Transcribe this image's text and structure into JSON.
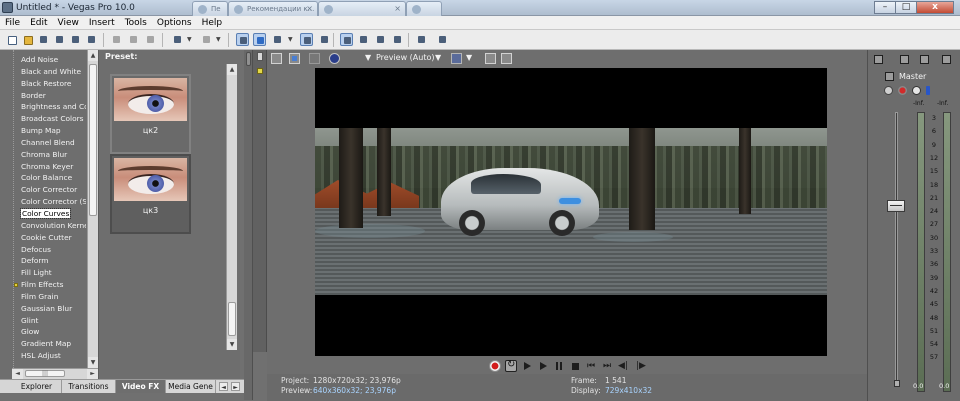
{
  "window": {
    "title": "Untitled * - Vegas Pro 10.0",
    "tabs": [
      {
        "label": "Пе"
      },
      {
        "label": "Рекомендации к..."
      },
      {
        "label": ""
      },
      {
        "label": ""
      }
    ],
    "controls": {
      "minimize": "–",
      "maximize": "□",
      "close": "x"
    }
  },
  "menu": [
    "File",
    "Edit",
    "View",
    "Insert",
    "Tools",
    "Options",
    "Help"
  ],
  "toolbar": {
    "icons": [
      "new-icon",
      "open-icon",
      "save-icon",
      "save-as-icon",
      "render-icon",
      "properties-icon",
      "cut-icon",
      "copy-icon",
      "paste-icon",
      "undo-icon",
      "redo-icon",
      "normal-edit-tool-icon",
      "envelope-tool-icon",
      "selection-tool-icon",
      "zoom-tool-icon",
      "snapping-icon",
      "auto-crossfade-icon",
      "ripple-icon",
      "lock-envelopes-icon",
      "ignore-grouping-icon",
      "what-is-this-icon"
    ]
  },
  "fx": {
    "items": [
      "Add Noise",
      "Black and White",
      "Black Restore",
      "Border",
      "Brightness and Cor",
      "Broadcast Colors",
      "Bump Map",
      "Channel Blend",
      "Chroma Blur",
      "Chroma Keyer",
      "Color Balance",
      "Color Corrector",
      "Color Corrector (Se",
      "Color Curves",
      "Convolution Kernel",
      "Cookie Cutter",
      "Defocus",
      "Deform",
      "Fill Light",
      "Film Effects",
      "Film Grain",
      "Gaussian Blur",
      "Glint",
      "Glow",
      "Gradient Map",
      "HSL Adjust"
    ],
    "selected": "Color Curves",
    "starred": "Film Effects",
    "hscroll_thumb": "|||"
  },
  "presets": {
    "label": "Preset:",
    "items": [
      {
        "name": "цк2",
        "selected": false
      },
      {
        "name": "цк3",
        "selected": true
      }
    ]
  },
  "tabs": [
    "Explorer",
    "Transitions",
    "Video FX",
    "Media Gene"
  ],
  "active_tab": "Video FX",
  "preview": {
    "quality": "Preview (Auto)",
    "project_label": "Project:",
    "project_value": "1280x720x32; 23,976p",
    "preview_label": "Preview:",
    "preview_value": "640x360x32; 23,976p",
    "frame_label": "Frame:",
    "frame_value": "1 541",
    "display_label": "Display:",
    "display_value": "729x410x32"
  },
  "master": {
    "label": "Master",
    "top_readouts": [
      "-Inf.",
      "-Inf."
    ],
    "scale": [
      "3",
      "6",
      "9",
      "12",
      "15",
      "18",
      "21",
      "24",
      "27",
      "30",
      "33",
      "36",
      "39",
      "42",
      "45",
      "48",
      "51",
      "54",
      "57"
    ],
    "bottom_readouts": [
      "0.0",
      "0.0"
    ]
  },
  "colors": {
    "panel": "#6e6e6e",
    "accent_selected": "#b9d0ee",
    "info_value": "#a9d4ff",
    "record": "#d21d1d"
  }
}
